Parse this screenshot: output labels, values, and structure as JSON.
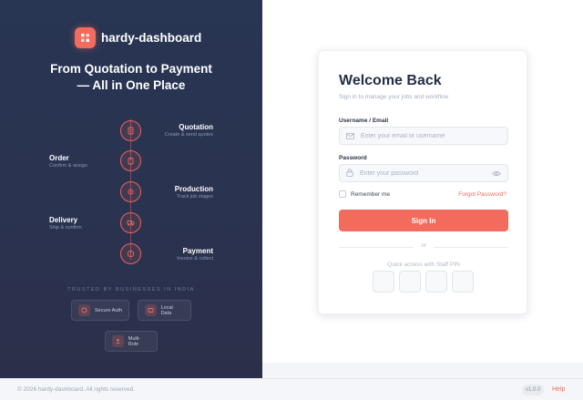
{
  "brand": {
    "name": "hardy-dashboard",
    "logo_icon": "grid-icon"
  },
  "hero": {
    "line1": "From Quotation to Payment",
    "line2": "— All in One Place"
  },
  "steps": [
    {
      "title": "Quotation",
      "subtitle": "Create & send quotes",
      "icon": "document-icon"
    },
    {
      "title": "Order",
      "subtitle": "Confirm & assign",
      "icon": "clipboard-icon"
    },
    {
      "title": "Production",
      "subtitle": "Track job stages",
      "icon": "gear-icon"
    },
    {
      "title": "Delivery",
      "subtitle": "Ship & confirm",
      "icon": "truck-icon"
    },
    {
      "title": "Payment",
      "subtitle": "Invoice & collect",
      "icon": "dollar-icon"
    }
  ],
  "trusted": "TRUSTED BY BUSINESSES IN INDIA",
  "badges": [
    {
      "label": "Secure Auth",
      "icon": "shield-icon"
    },
    {
      "label": "Local Data",
      "icon": "database-icon"
    },
    {
      "label": "Multi-Role",
      "icon": "users-icon"
    }
  ],
  "login": {
    "title": "Welcome Back",
    "subtitle": "Sign in to manage your jobs and workflow",
    "username_label": "Username / Email",
    "username_placeholder": "Enter your email or username",
    "username_value": "",
    "password_label": "Password",
    "password_placeholder": "Enter your password",
    "password_value": "",
    "remember_label": "Remember me",
    "remember_checked": false,
    "forgot_label": "Forgot Password?",
    "signin_label": "Sign In",
    "divider": "or",
    "quick_access": "Quick access with Staff PIN"
  },
  "footer": {
    "copyright": "© 2026 hardy-dashboard. All rights reserved.",
    "version": "v1.0.0",
    "help": "Help"
  },
  "colors": {
    "accent": "#f26b5d",
    "navy": "#283553"
  }
}
